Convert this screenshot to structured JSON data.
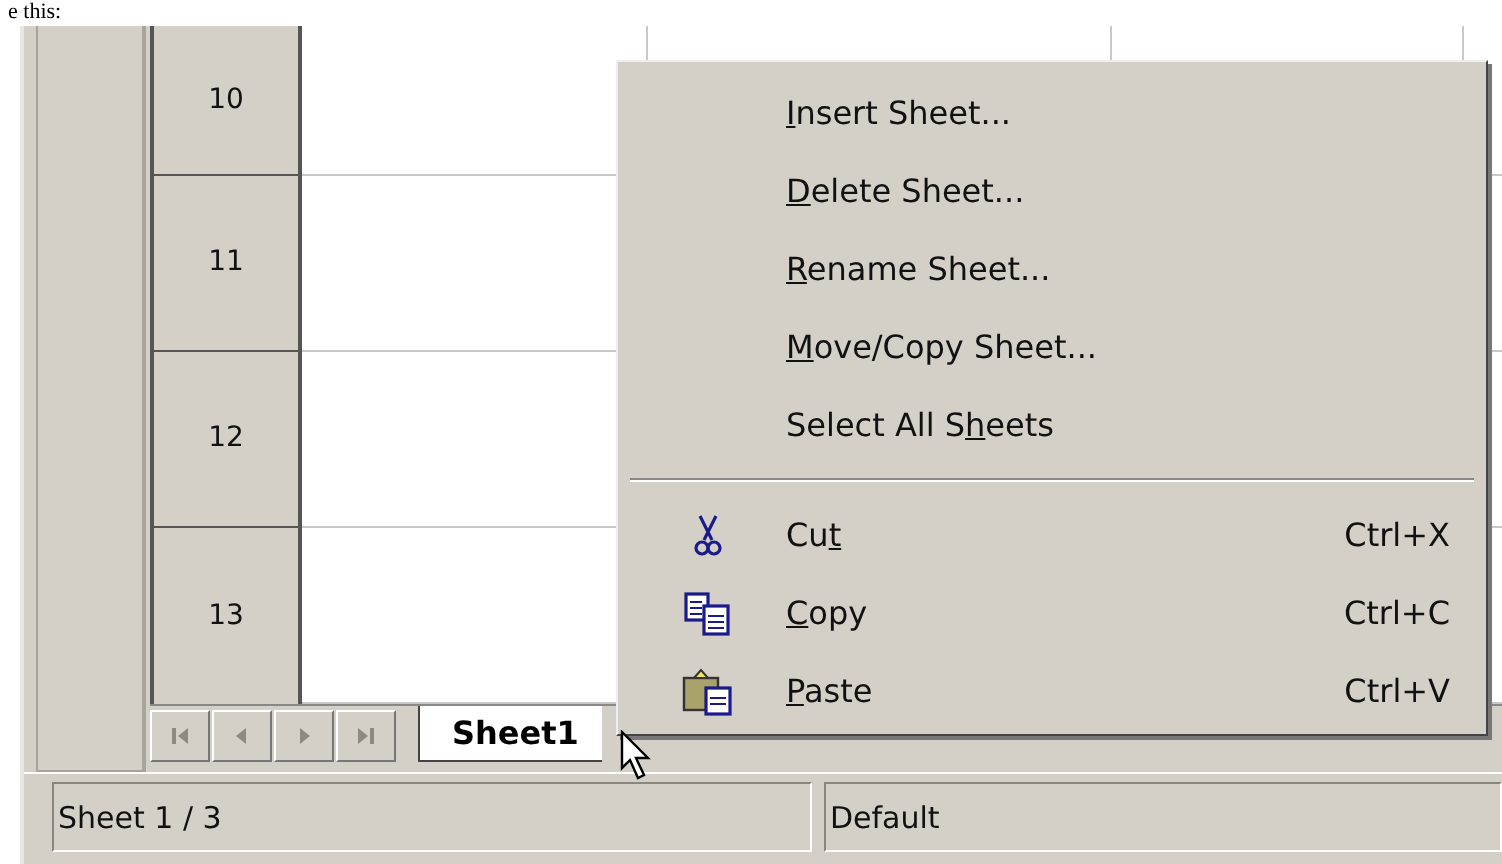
{
  "page_text": "e this:",
  "rows": [
    {
      "label": "10"
    },
    {
      "label": "11"
    },
    {
      "label": "12"
    },
    {
      "label": "13"
    }
  ],
  "tab_nav": [
    {
      "kind": "first"
    },
    {
      "kind": "prev"
    },
    {
      "kind": "next"
    },
    {
      "kind": "last"
    }
  ],
  "sheet_tabs": [
    {
      "label": "Sheet1",
      "selected": true
    }
  ],
  "context_menu": {
    "items": [
      {
        "kind": "item",
        "key": "I",
        "post": "nsert Sheet..."
      },
      {
        "kind": "item",
        "key": "D",
        "post": "elete Sheet..."
      },
      {
        "kind": "item",
        "key": "R",
        "post": "ename Sheet..."
      },
      {
        "kind": "item",
        "key": "M",
        "post": "ove/Copy Sheet..."
      },
      {
        "kind": "item",
        "pre": "Select All S",
        "key": "h",
        "post": "eets"
      },
      {
        "kind": "separator"
      },
      {
        "kind": "action",
        "pre": "Cu",
        "key": "t",
        "shortcut": "Ctrl+X"
      },
      {
        "kind": "action",
        "key": "C",
        "post": "opy",
        "shortcut": "Ctrl+C"
      },
      {
        "kind": "action",
        "key": "P",
        "post": "aste",
        "shortcut": "Ctrl+V"
      }
    ]
  },
  "status_bar": {
    "sheet": "Sheet 1 / 3",
    "style": "Default"
  }
}
